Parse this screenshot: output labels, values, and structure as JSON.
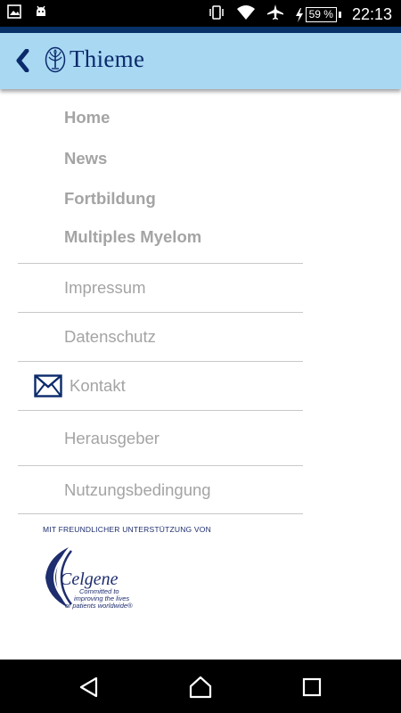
{
  "status_bar": {
    "battery": "59 %",
    "time": "22:13"
  },
  "header": {
    "logo_text": "Thieme"
  },
  "menu": {
    "main_items": [
      {
        "label": "Home"
      },
      {
        "label": "News"
      },
      {
        "label": "Fortbildung"
      },
      {
        "label": "Multiples Myelom"
      }
    ],
    "sub_items": [
      {
        "label": "Impressum"
      },
      {
        "label": "Datenschutz"
      },
      {
        "label": "Kontakt"
      },
      {
        "label": "Herausgeber"
      },
      {
        "label": "Nutzungsbedingung"
      }
    ]
  },
  "sponsor": {
    "label": "MIT FREUNDLICHER UNTERSTÜTZUNG VON",
    "name": "Celgene",
    "tagline_lines": [
      "Committed to",
      "improving the lives",
      "of patients worldwide®"
    ]
  },
  "colors": {
    "header_bg": "#a9d8f3",
    "accent": "#083167",
    "menu_text": "#a4a4a4",
    "divider": "#c8c8c8"
  }
}
